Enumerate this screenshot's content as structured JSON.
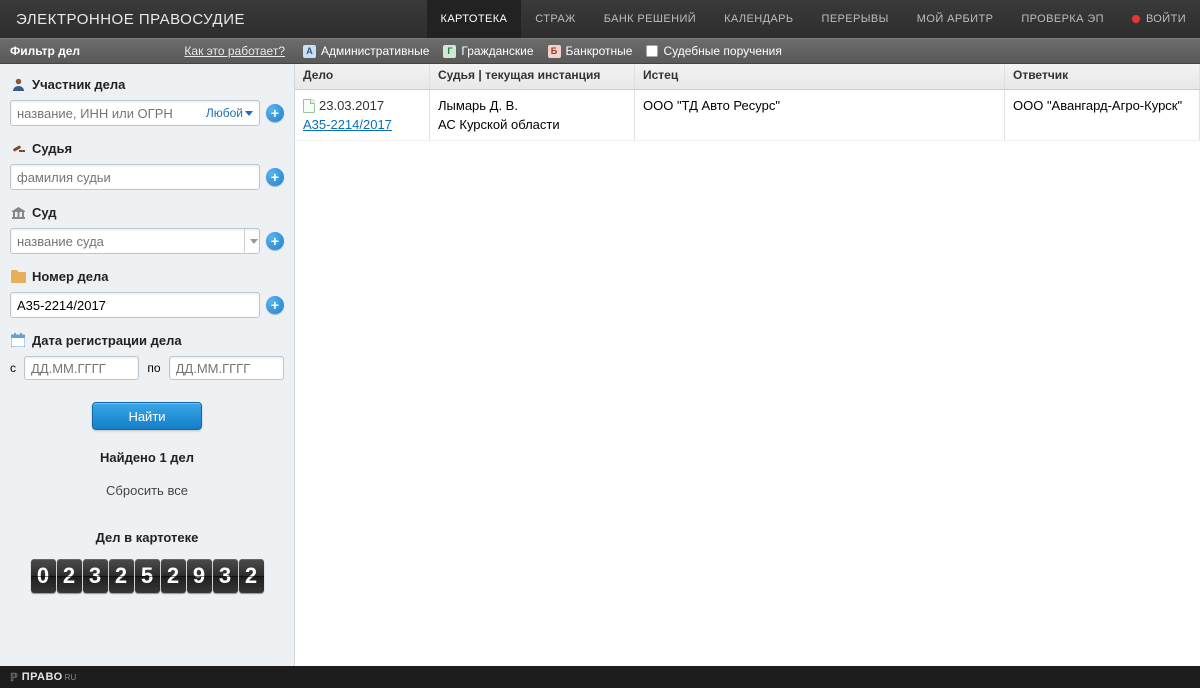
{
  "header": {
    "logo": "ЭЛЕКТРОННОЕ ПРАВОСУДИЕ",
    "nav": [
      "КАРТОТЕКА",
      "СТРАЖ",
      "БАНК РЕШЕНИЙ",
      "КАЛЕНДАРЬ",
      "ПЕРЕРЫВЫ",
      "МОЙ АРБИТР",
      "ПРОВЕРКА ЭП"
    ],
    "login": "ВОЙТИ"
  },
  "subbar": {
    "filter_title": "Фильтр дел",
    "help": "Как это работает?",
    "tabs": {
      "admin": "Административные",
      "civil": "Гражданские",
      "bankrupt": "Банкротные",
      "order": "Судебные поручения"
    }
  },
  "sidebar": {
    "participant": {
      "label": "Участник дела",
      "placeholder": "название, ИНН или ОГРН",
      "suffix": "Любой"
    },
    "judge": {
      "label": "Судья",
      "placeholder": "фамилия судьи"
    },
    "court": {
      "label": "Суд",
      "placeholder": "название суда"
    },
    "case_number": {
      "label": "Номер дела",
      "value": "А35-2214/2017"
    },
    "reg_date": {
      "label": "Дата регистрации дела",
      "from_label": "с",
      "to_label": "по",
      "placeholder": "ДД.ММ.ГГГГ"
    },
    "search_btn": "Найти",
    "found": "Найдено 1 дел",
    "reset": "Сбросить все",
    "counter_title": "Дел в картотеке",
    "counter": "023252932"
  },
  "table": {
    "headers": {
      "case": "Дело",
      "judge": "Судья | текущая инстанция",
      "plaintiff": "Истец",
      "defendant": "Ответчик"
    },
    "rows": [
      {
        "date": "23.03.2017",
        "number": "А35-2214/2017",
        "judge": "Лымарь Д. В.",
        "court": "АС Курской области",
        "plaintiff": "ООО \"ТД Авто Ресурс\"",
        "defendant": "ООО \"Авангард-Агро-Курск\""
      }
    ]
  },
  "footer": {
    "brand": "ПРАВО",
    "suffix": "RU"
  }
}
